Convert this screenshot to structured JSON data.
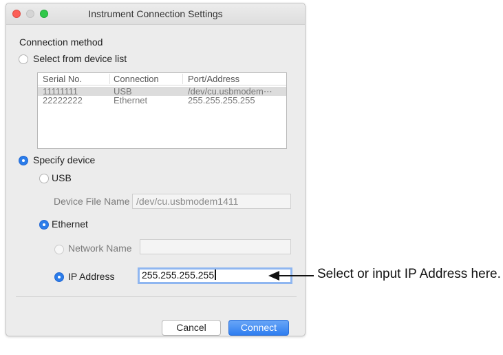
{
  "window": {
    "title": "Instrument Connection Settings"
  },
  "connection_method": {
    "heading": "Connection method",
    "option_device_list": "Select from device list",
    "option_specify_device": "Specify device",
    "selected": "specify_device"
  },
  "device_list": {
    "columns": [
      "Serial No.",
      "Connection",
      "Port/Address"
    ],
    "rows": [
      {
        "serial": "11111111",
        "connection": "USB",
        "address": "/dev/cu.usbmodem⋯",
        "selected": true
      },
      {
        "serial": "22222222",
        "connection": "Ethernet",
        "address": "255.255.255.255",
        "selected": false
      }
    ]
  },
  "specify_device": {
    "usb_label": "USB",
    "device_file_label": "Device File Name",
    "device_file_value": "/dev/cu.usbmodem1411",
    "ethernet_label": "Ethernet",
    "network_name_label": "Network Name",
    "network_name_value": "",
    "ip_address_label": "IP Address",
    "ip_address_value": "255.255.255.255",
    "selected_interface": "ethernet",
    "selected_ethernet_mode": "ip_address"
  },
  "buttons": {
    "cancel": "Cancel",
    "connect": "Connect"
  },
  "annotation": {
    "text": "Select or input IP Address here."
  }
}
